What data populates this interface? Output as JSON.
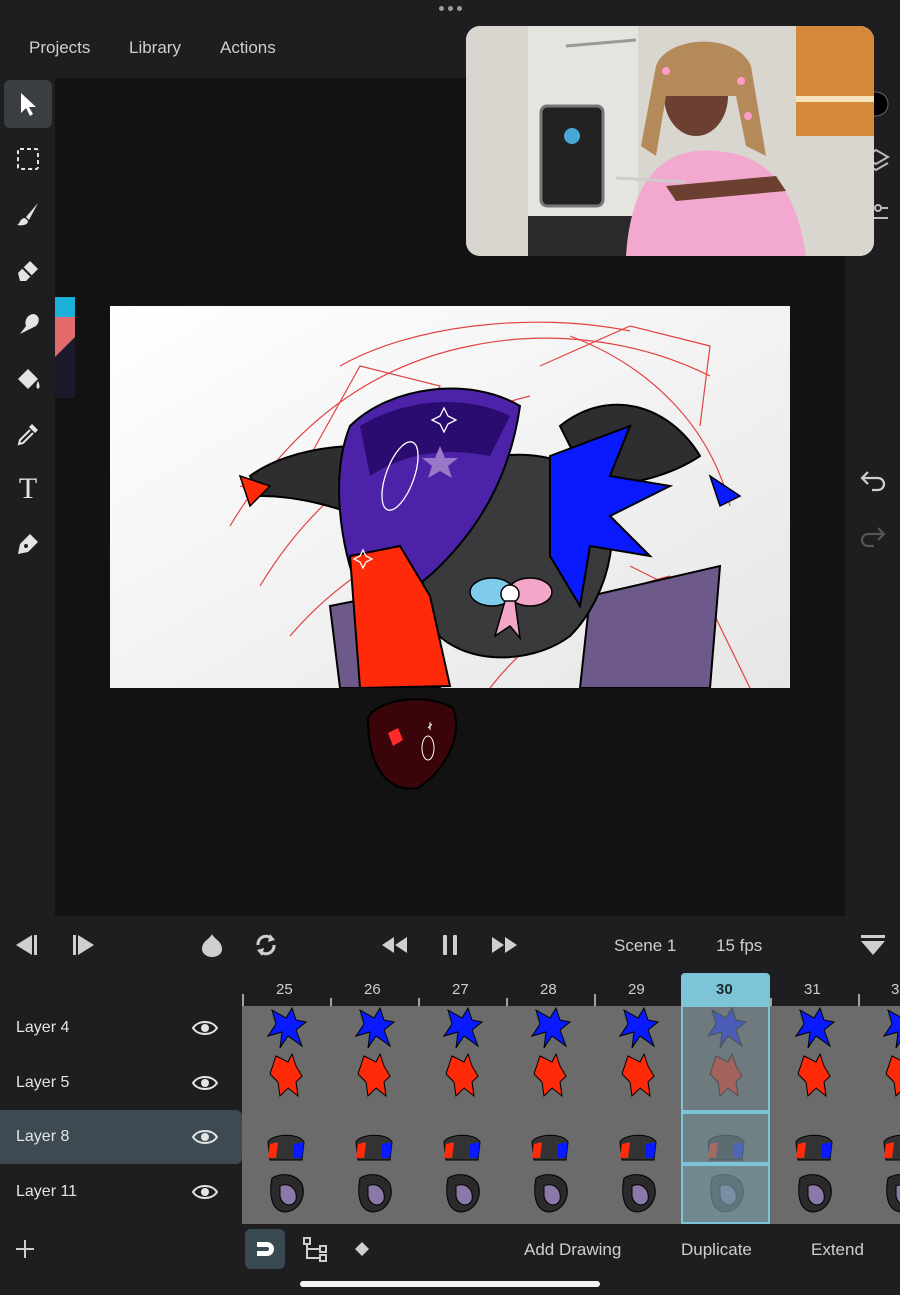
{
  "top_menu": {
    "projects": "Projects",
    "library": "Library",
    "actions": "Actions"
  },
  "tools": [
    {
      "name": "select-tool",
      "icon": "arrow-pointer-icon",
      "active": true
    },
    {
      "name": "marquee-tool",
      "icon": "dashed-selection-icon"
    },
    {
      "name": "brush-tool",
      "icon": "brush-icon"
    },
    {
      "name": "eraser-tool",
      "icon": "eraser-icon"
    },
    {
      "name": "smudge-tool",
      "icon": "smudge-icon"
    },
    {
      "name": "fill-tool",
      "icon": "paint-bucket-icon"
    },
    {
      "name": "eyedropper-tool",
      "icon": "eyedropper-icon"
    },
    {
      "name": "text-tool",
      "icon": "text-icon",
      "glyph": "T"
    },
    {
      "name": "pen-tool",
      "icon": "pen-nib-icon"
    }
  ],
  "transport": {
    "scene": "Scene 1",
    "fps": "15 fps",
    "icons": [
      "prev-frame-icon",
      "next-frame-icon",
      "onion-skin-icon",
      "loop-icon",
      "rewind-icon",
      "pause-icon",
      "fast-forward-icon",
      "timeline-collapse-icon"
    ]
  },
  "timeline": {
    "frame_numbers": [
      "25",
      "26",
      "27",
      "28",
      "29",
      "30",
      "31",
      "3"
    ],
    "current_frame": "30",
    "layers": [
      {
        "label": "Layer 4",
        "selected": false
      },
      {
        "label": "Layer 5",
        "selected": false
      },
      {
        "label": "Layer 8",
        "selected": true
      },
      {
        "label": "Layer 11",
        "selected": false
      }
    ]
  },
  "bottom_bar": {
    "add_drawing": "Add Drawing",
    "duplicate": "Duplicate",
    "extend": "Extend",
    "icons": [
      "add-layer-icon",
      "snap-mode-icon",
      "tween-path-icon",
      "keyframe-diamond-icon"
    ]
  },
  "colors": {
    "blue": "#0a1aff",
    "red": "#ff2a0a",
    "purple": "#5a2fb0",
    "selected_cell": "#7ec4d8",
    "selected_row": "#3d4a52"
  }
}
